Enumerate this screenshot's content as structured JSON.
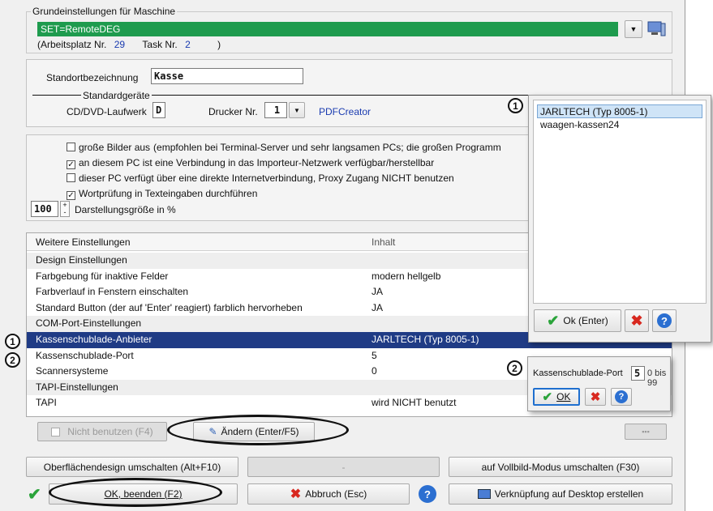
{
  "machine": {
    "legend": "Grundeinstellungen für Maschine",
    "set_value": "SET=RemoteDEG",
    "workplace_label": "(Arbeitsplatz Nr.",
    "workplace_nr": "29",
    "task_label": "Task Nr.",
    "task_nr": "2",
    "close_paren": ")"
  },
  "location": {
    "label": "Standortbezeichnung",
    "value": "Kasse"
  },
  "devices": {
    "legend": "Standardgeräte",
    "cd_label": "CD/DVD-Laufwerk",
    "cd_value": "D",
    "printer_label": "Drucker Nr.",
    "printer_value": "1",
    "printer_name": "PDFCreator"
  },
  "options": [
    {
      "checked": false,
      "label": "große Bilder aus",
      "note": "(empfohlen bei Terminal-Server und sehr langsamen PCs; die großen Programm"
    },
    {
      "checked": true,
      "label": "an diesem PC ist eine Verbindung in das Importeur-Netzwerk verfügbar/herstellbar",
      "note": ""
    },
    {
      "checked": false,
      "label": "dieser PC verfügt über eine direkte Internetverbindung, Proxy Zugang NICHT benutzen",
      "note": ""
    },
    {
      "checked": true,
      "label": "Wortprüfung in Texteingaben durchführen",
      "note": ""
    }
  ],
  "size": {
    "value": "100",
    "label": "Darstellungsgröße in %"
  },
  "grid": {
    "col1": "Weitere Einstellungen",
    "col2": "Inhalt",
    "rows": [
      {
        "name": "Design Einstellungen",
        "value": "",
        "type": "group"
      },
      {
        "name": "Farbgebung für inaktive Felder",
        "value": "modern hellgelb",
        "type": "item"
      },
      {
        "name": "Farbverlauf in Fenstern einschalten",
        "value": "JA",
        "type": "item"
      },
      {
        "name": "Standard Button (der auf 'Enter' reagiert) farblich hervorheben",
        "value": "JA",
        "type": "item"
      },
      {
        "name": "COM-Port-Einstellungen",
        "value": "",
        "type": "group"
      },
      {
        "name": "Kassenschublade-Anbieter",
        "value": "JARLTECH (Typ 8005-1)",
        "type": "selected"
      },
      {
        "name": "Kassenschublade-Port",
        "value": "5",
        "type": "item"
      },
      {
        "name": "Scannersysteme",
        "value": "0",
        "type": "item"
      },
      {
        "name": "TAPI-Einstellungen",
        "value": "",
        "type": "group"
      },
      {
        "name": "TAPI",
        "value": "wird NICHT benutzt",
        "type": "item"
      }
    ]
  },
  "buttons": {
    "nicht_benutzen": "Nicht benutzen (F4)",
    "aendern": "Ändern (Enter/F5)",
    "theme": "Oberflächendesign umschalten (Alt+F10)",
    "dash": "-",
    "fullscreen": "auf Vollbild-Modus umschalten (F30)",
    "ok": "OK, beenden (F2)",
    "abbruch": "Abbruch (Esc)",
    "desktop_link": "Verknüpfung auf Desktop erstellen"
  },
  "badges": {
    "one": "1",
    "two": "2"
  },
  "popup1": {
    "items": [
      "JARLTECH (Typ 8005-1)",
      "waagen-kassen24"
    ],
    "ok_label": "Ok (Enter)"
  },
  "popup2": {
    "label": "Kassenschublade-Port",
    "value": "5",
    "range": "0 bis 99",
    "ok_label": "OK"
  },
  "colors": {
    "accent_green": "#1e9b4e",
    "selection_blue": "#1f3b85",
    "link_blue": "#1a3bb0"
  },
  "icons": [
    "dropdown-arrow-icon",
    "monitor-icon",
    "check-icon",
    "cross-icon",
    "help-icon",
    "edit-icon",
    "desktop-shortcut-icon"
  ]
}
